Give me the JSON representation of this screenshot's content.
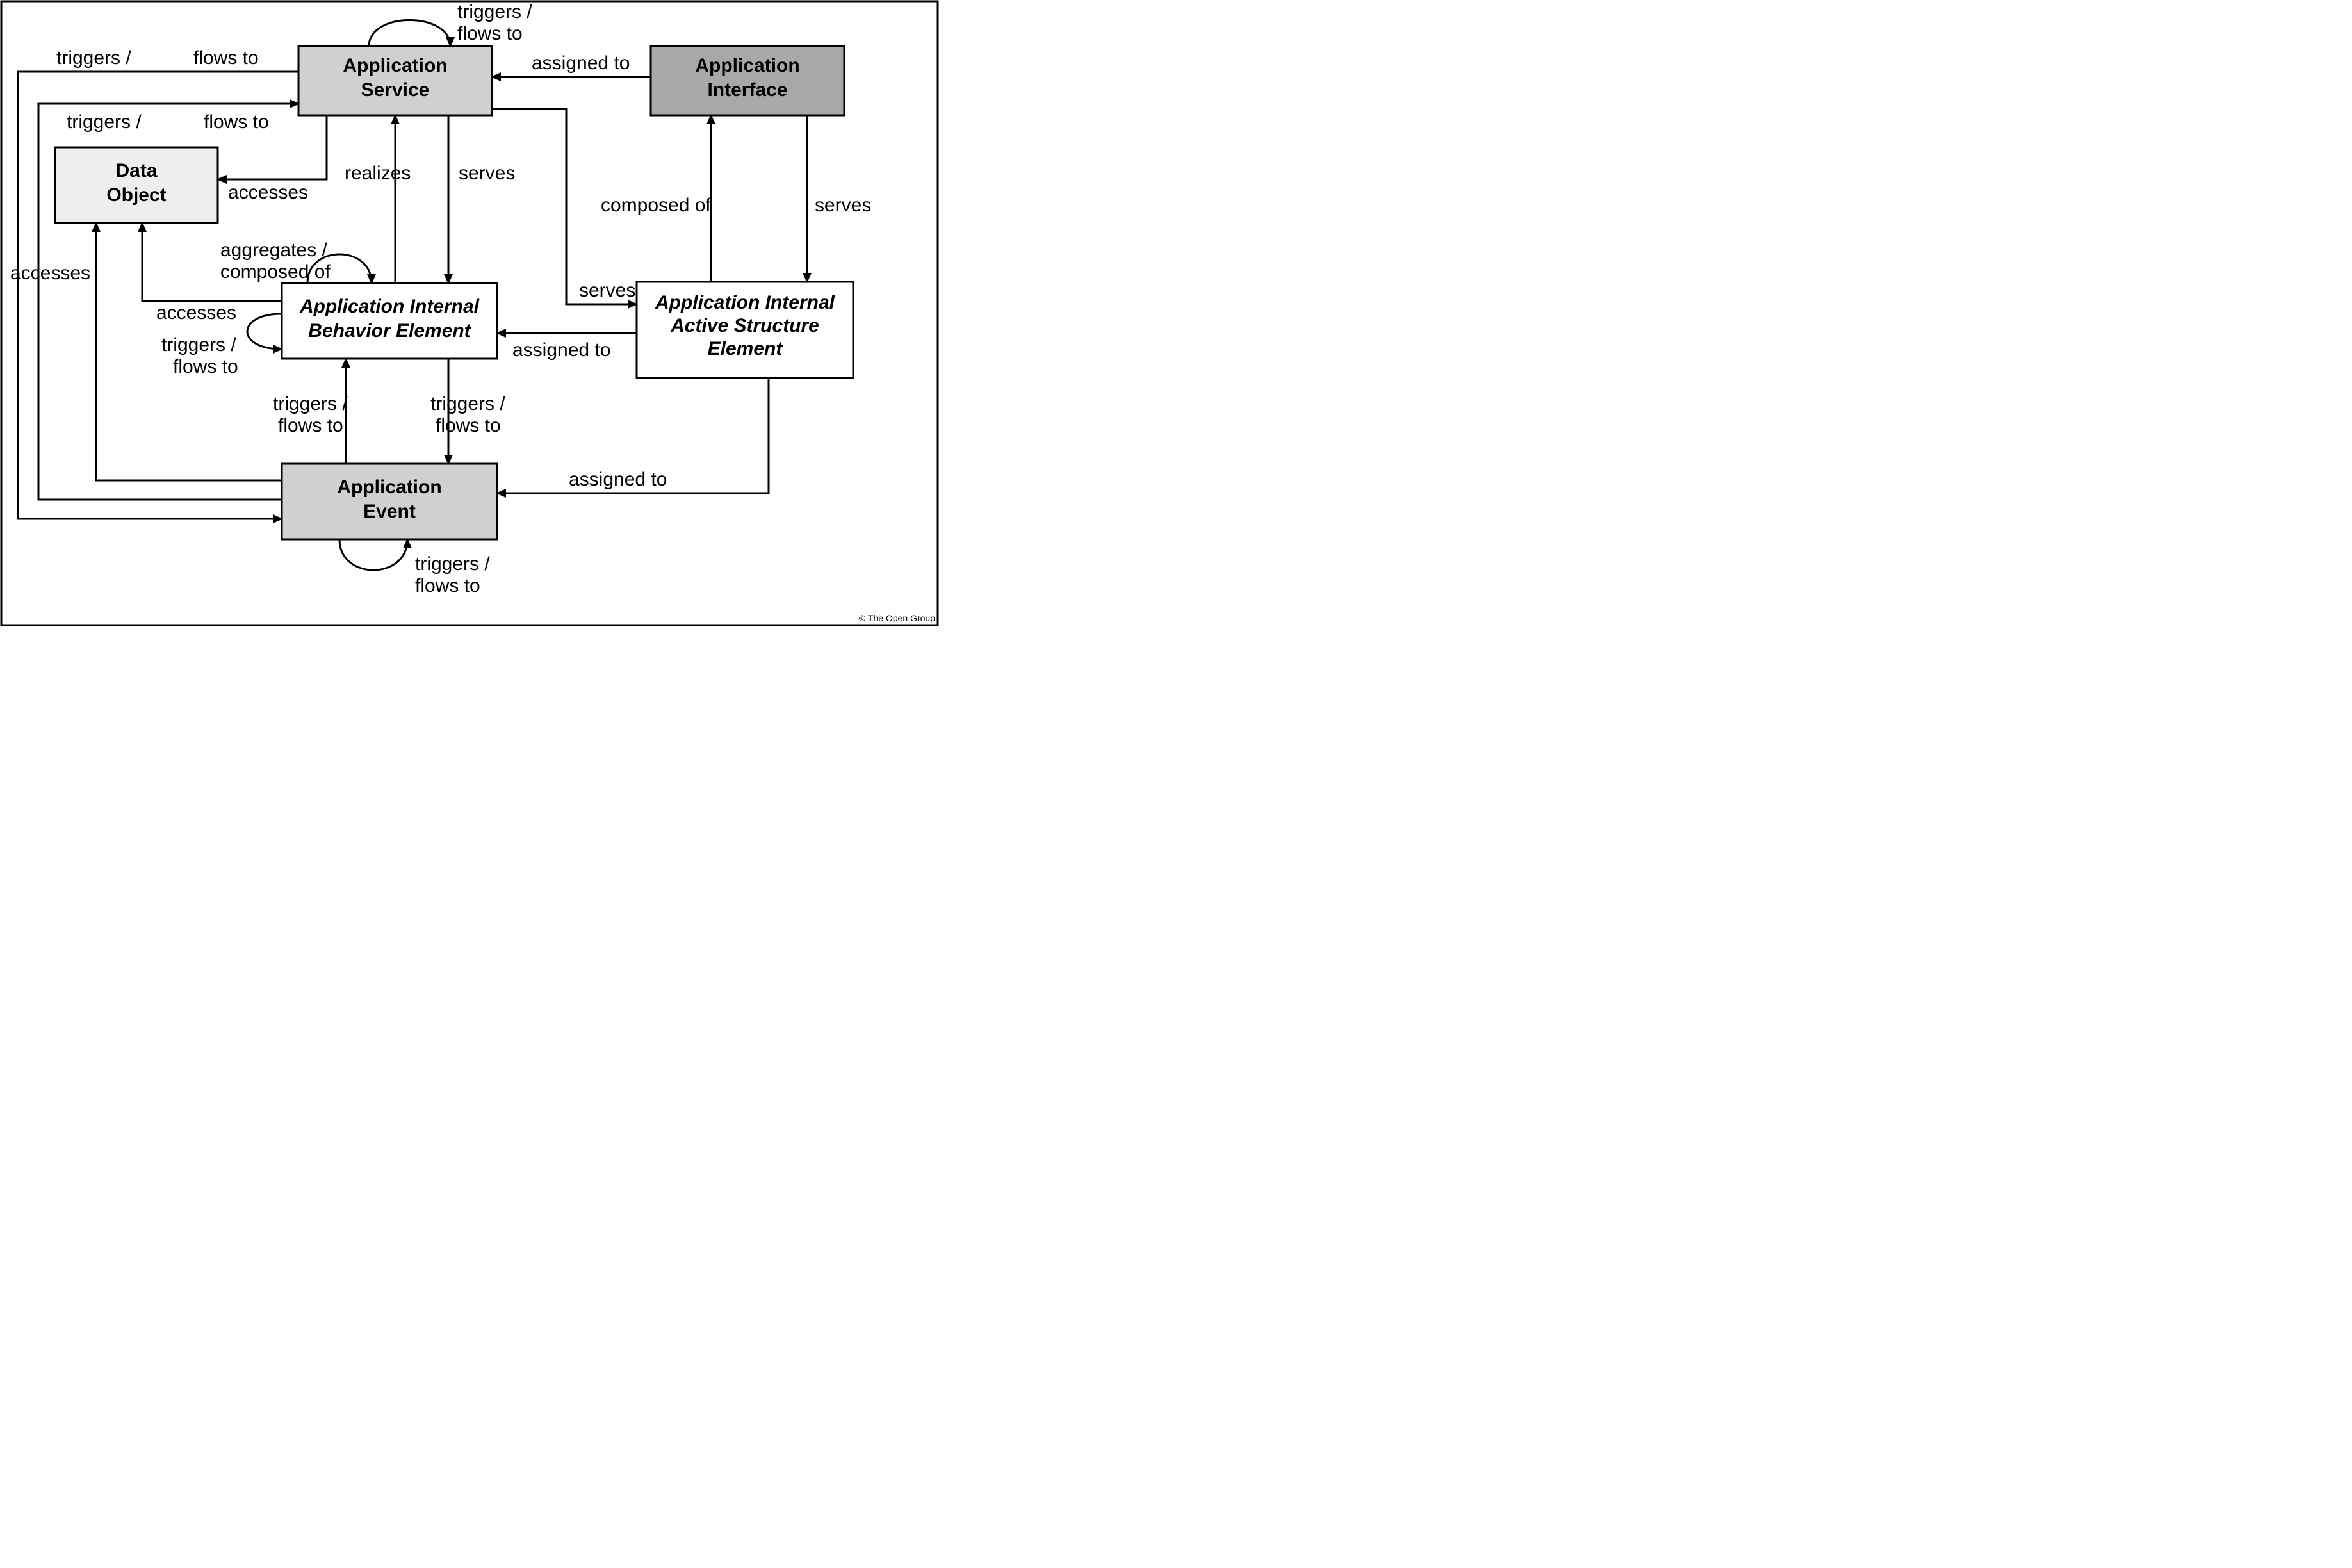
{
  "nodes": {
    "appService": {
      "l1": "Application",
      "l2": "Service"
    },
    "appInterface": {
      "l1": "Application",
      "l2": "Interface"
    },
    "dataObject": {
      "l1": "Data",
      "l2": "Object"
    },
    "behavior": {
      "l1": "Application Internal",
      "l2": "Behavior Element"
    },
    "active": {
      "l1": "Application Internal",
      "l2": "Active Structure",
      "l3": "Element"
    },
    "event": {
      "l1": "Application",
      "l2": "Event"
    }
  },
  "labels": {
    "triggersFlows1": "triggers /",
    "triggersFlows2": "flows to",
    "assignedTo": "assigned to",
    "accesses": "accesses",
    "realizes": "realizes",
    "serves": "serves",
    "composedOf": "composed of",
    "aggComp1": "aggregates /",
    "aggComp2": "composed of",
    "footer": "© The Open Group"
  }
}
